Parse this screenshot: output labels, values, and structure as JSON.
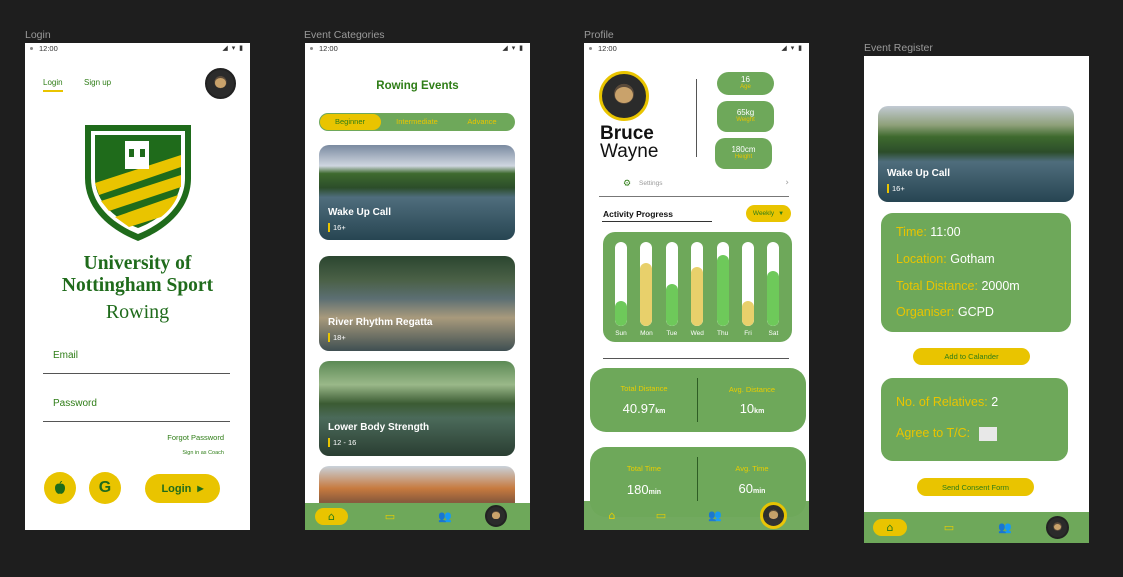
{
  "frames": {
    "login": "Login",
    "categories": "Event Categories",
    "profile": "Profile",
    "register": "Event Register"
  },
  "status_time": "12:00",
  "login": {
    "tab_login": "Login",
    "tab_signup": "Sign up",
    "logo_line1": "University of",
    "logo_line2": "Nottingham Sport",
    "logo_line3": "Rowing",
    "email_label": "Email",
    "password_label": "Password",
    "forgot": "Forgot Password",
    "coach": "Sign in as Coach",
    "login_button": "Login",
    "apple_icon": "apple-icon",
    "google_letter": "G"
  },
  "categories": {
    "title": "Rowing Events",
    "tabs": [
      "Beginner",
      "Intermediate",
      "Advance"
    ],
    "cards": [
      {
        "title": "Wake Up Call",
        "age": "16+"
      },
      {
        "title": "River Rhythm Regatta",
        "age": "18+"
      },
      {
        "title": "Lower Body Strength",
        "age": "12 - 16"
      }
    ]
  },
  "profile": {
    "first_name": "Bruce",
    "last_name": "Wayne",
    "age_value": "16",
    "age_label": "Age",
    "weight_value": "65kg",
    "weight_label": "Weight",
    "height_value": "180cm",
    "height_label": "Height",
    "settings": "Settings",
    "activity_title": "Activity Progress",
    "period": "Weekly",
    "days": [
      "Sun",
      "Mon",
      "Tue",
      "Wed",
      "Thu",
      "Fri",
      "Sat"
    ],
    "progress": [
      0.3,
      0.75,
      0.5,
      0.7,
      0.85,
      0.3,
      0.65
    ],
    "progress_colors": [
      "#6ec95a",
      "#e8d06b",
      "#6ec95a",
      "#e8d06b",
      "#6ec95a",
      "#e8d06b",
      "#6ec95a"
    ],
    "total_distance_label": "Total Distance",
    "total_distance_value": "40.97",
    "total_distance_unit": "km",
    "avg_distance_label": "Avg. Distance",
    "avg_distance_value": "10",
    "avg_distance_unit": "km",
    "total_time_label": "Total Time",
    "total_time_value": "180",
    "total_time_unit": "min",
    "avg_time_label": "Avg. Time",
    "avg_time_value": "60",
    "avg_time_unit": "min"
  },
  "register": {
    "card_title": "Wake Up Call",
    "card_age": "16+",
    "time_label": "Time:",
    "time_value": "11:00",
    "location_label": "Location:",
    "location_value": "Gotham",
    "distance_label": "Total Distance:",
    "distance_value": "2000m",
    "organiser_label": "Organiser:",
    "organiser_value": "GCPD",
    "add_calendar": "Add to Calander",
    "relatives_label": "No. of Relatives:",
    "relatives_value": "2",
    "agree_label": "Agree to T/C:",
    "send_consent": "Send Consent Form"
  },
  "colors": {
    "brand_green": "#2e7d16",
    "accent_yellow": "#e9c400",
    "panel_green": "#6ea85a",
    "background": "#1e1e1e"
  }
}
